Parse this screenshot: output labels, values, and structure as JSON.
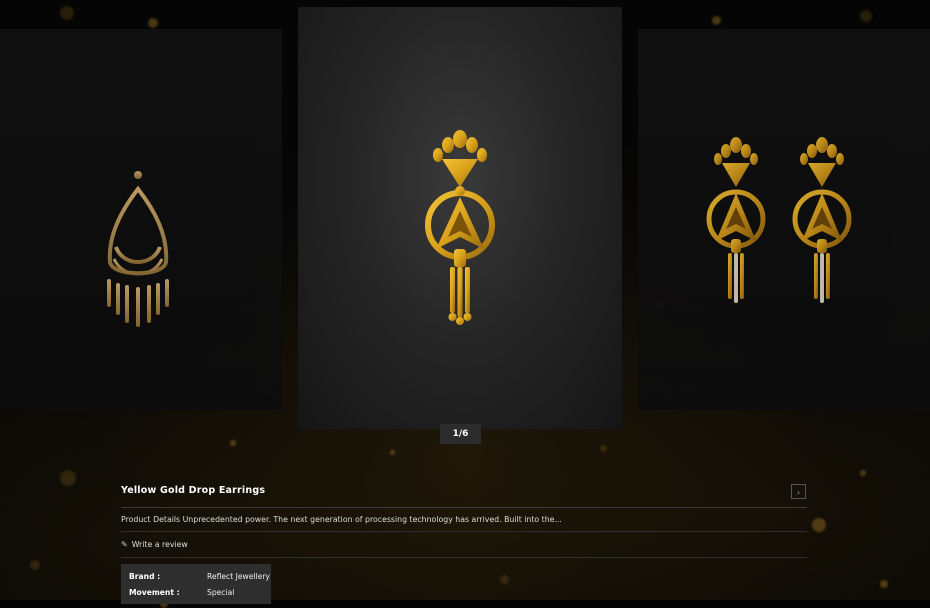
{
  "gallery": {
    "counter": "1/6",
    "slides": [
      {
        "name": "chandbali-earring"
      },
      {
        "name": "yellow-gold-drop-pendant"
      },
      {
        "name": "yellow-gold-drop-earrings-pair"
      }
    ]
  },
  "product": {
    "title": "Yellow Gold Drop Earrings",
    "next_icon": "›",
    "description": "Product Details Unprecedented power. The next generation of processing technology has arrived. Built into the...",
    "review_icon": "✎",
    "review_label": "Write a review",
    "specs": [
      {
        "label": "Brand :",
        "value": "Reflect Jewellery"
      },
      {
        "label": "Movement :",
        "value": "Special"
      }
    ]
  },
  "colors": {
    "gold": "#d9a21a",
    "gold_dark": "#a97612",
    "background": "#050505"
  }
}
